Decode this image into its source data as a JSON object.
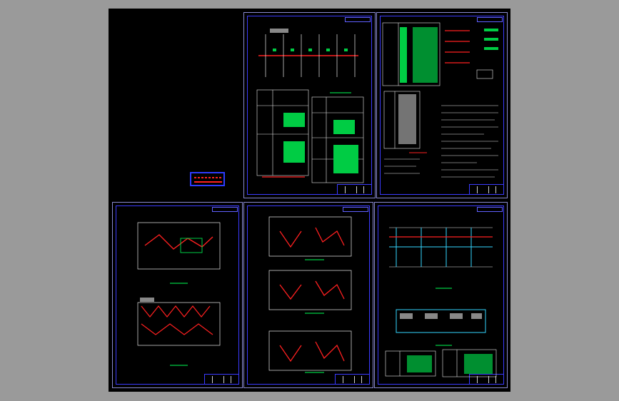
{
  "app": {
    "background": "#9a9a9a",
    "viewport_background": "#000000"
  },
  "sheets": [
    {
      "name": "sheet-piping-layout-notes",
      "accent": "#ff2020"
    },
    {
      "name": "sheet-system-diagram-specs",
      "accent": "#00cc44"
    },
    {
      "name": "sheet-floor-plan-a",
      "accent": "#ff2020"
    },
    {
      "name": "sheet-floor-plan-b",
      "accent": "#ff2020"
    },
    {
      "name": "sheet-section-detail",
      "accent": "#33d6ff"
    }
  ],
  "colors": {
    "frame": "#3b3bff",
    "pipe": "#ff2020",
    "green": "#00cc44",
    "cyan": "#33d6ff",
    "white": "#e8e8e8",
    "yellow": "#ffee33",
    "magenta": "#ff33ff"
  },
  "icons": [
    "legend-icon"
  ]
}
